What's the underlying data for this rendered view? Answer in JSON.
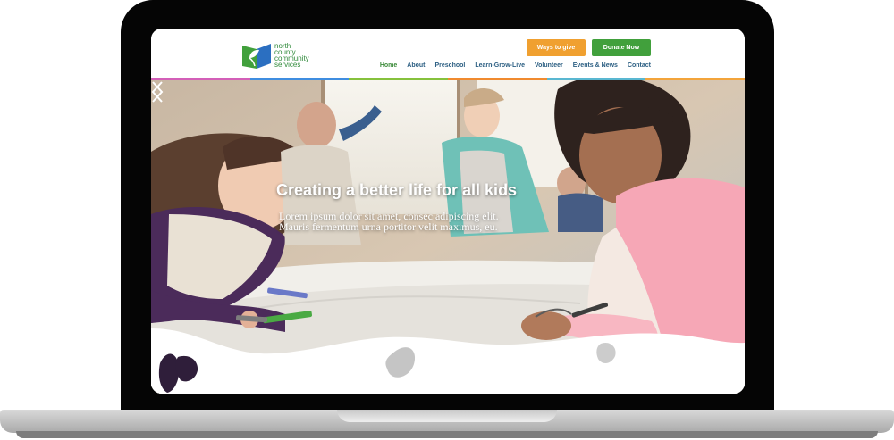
{
  "site": {
    "logo_lines": [
      "north",
      "county",
      "community",
      "services"
    ],
    "colors": {
      "green": "#41a03c",
      "orange": "#f0a030",
      "nav_blue": "#2c5f83",
      "stripe": [
        "#d35fb8",
        "#3f8de0",
        "#86c13c",
        "#f08a2f",
        "#59b7d1",
        "#f3a43b"
      ]
    }
  },
  "header": {
    "buttons": {
      "give": "Ways to give",
      "donate": "Donate Now"
    },
    "nav": [
      "Home",
      "About",
      "Preschool",
      "Learn-Grow-Live",
      "Volunteer",
      "Events & News",
      "Contact"
    ],
    "active_nav": "Home"
  },
  "hero": {
    "headline": "Creating a better life for all kids",
    "body": "Lorem ipsum dolor sit amet, consec adipiscing elit. Mauris fermentum urna portitor velit maximus, eu.",
    "prev_icon": "chevron-left-icon",
    "next_icon": "chevron-right-icon"
  }
}
